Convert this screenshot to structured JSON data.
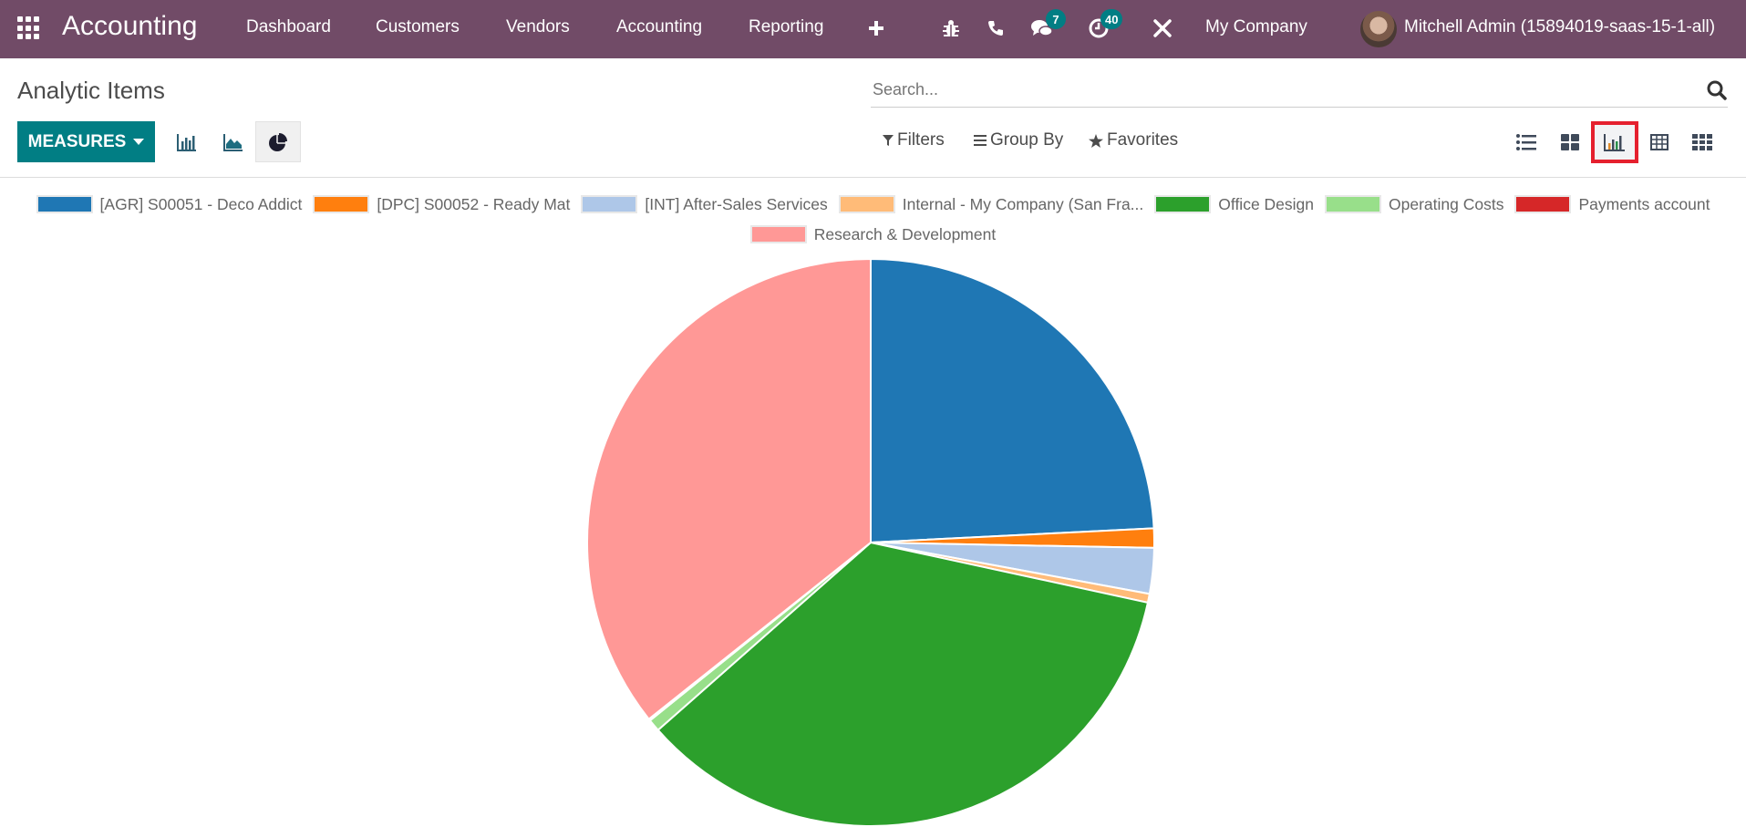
{
  "navbar": {
    "app_name": "Accounting",
    "menu": [
      "Dashboard",
      "Customers",
      "Vendors",
      "Accounting",
      "Reporting"
    ],
    "icons": [
      "apps-grid-icon",
      "plus-icon",
      "bug-icon",
      "phone-icon",
      "chat-icon",
      "activity-clock-icon",
      "tools-icon"
    ],
    "messages_badge": "7",
    "activities_badge": "40",
    "company": "My Company",
    "user": "Mitchell Admin (15894019-saas-15-1-all)"
  },
  "control_panel": {
    "title": "Analytic Items",
    "measures_label": "MEASURES",
    "chart_types": [
      "bar-chart",
      "line-chart",
      "pie-chart"
    ],
    "active_chart_type": "pie-chart",
    "search_placeholder": "Search...",
    "filters_label": "Filters",
    "group_by_label": "Group By",
    "favorites_label": "Favorites",
    "views": [
      "list",
      "kanban",
      "graph",
      "pivot",
      "grid"
    ],
    "active_view": "graph"
  },
  "colors": {
    "navbar": "#714B67",
    "primary": "#017E84",
    "highlight_box": "#E5202E"
  },
  "chart_data": {
    "type": "pie",
    "title": "",
    "legend_position": "top",
    "categories": [
      "[AGR] S00051 - Deco Addict",
      "[DPC] S00052 - Ready Mat",
      "[INT] After-Sales Services",
      "Internal - My Company (San Fra...",
      "Office Design",
      "Operating Costs",
      "Payments account",
      "Research & Development"
    ],
    "values": [
      24.2,
      1.1,
      2.6,
      0.5,
      35.1,
      0.7,
      0.1,
      35.7
    ],
    "unit": "percent (estimated)",
    "colors": [
      "#1f77b4",
      "#ff7f0e",
      "#aec7e8",
      "#ffbb78",
      "#2ca02c",
      "#98df8a",
      "#d62728",
      "#ff9896"
    ]
  }
}
